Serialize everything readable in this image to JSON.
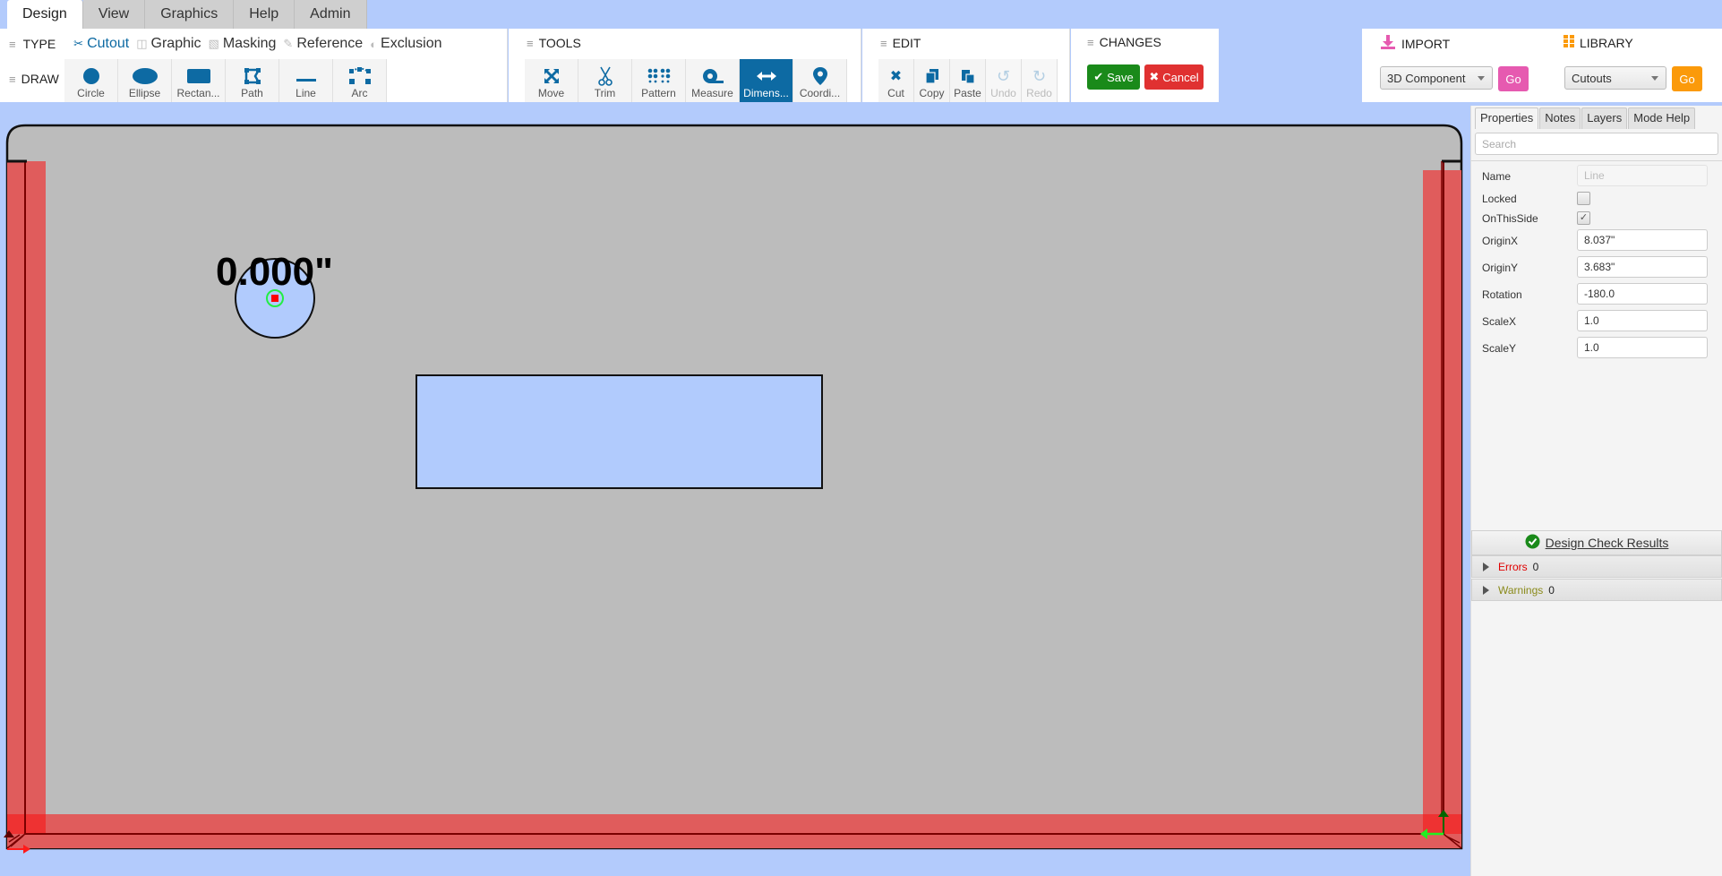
{
  "menu_tabs": [
    {
      "label": "Design",
      "active": true
    },
    {
      "label": "View",
      "active": false
    },
    {
      "label": "Graphics",
      "active": false
    },
    {
      "label": "Help",
      "active": false
    },
    {
      "label": "Admin",
      "active": false
    }
  ],
  "type_section": {
    "title": "TYPE",
    "items": [
      {
        "label": "Cutout",
        "icon": "scissors-icon",
        "active": true
      },
      {
        "label": "Graphic",
        "icon": "image-file-icon",
        "active": false
      },
      {
        "label": "Masking",
        "icon": "masking-tape-icon",
        "active": false
      },
      {
        "label": "Reference",
        "icon": "edit-icon",
        "active": false
      },
      {
        "label": "Exclusion",
        "icon": "half-circle-icon",
        "active": false
      }
    ]
  },
  "draw_section": {
    "title": "DRAW",
    "items": [
      {
        "label": "Circle",
        "icon": "circle-icon"
      },
      {
        "label": "Ellipse",
        "icon": "ellipse-icon"
      },
      {
        "label": "Rectan...",
        "icon": "rectangle-icon"
      },
      {
        "label": "Path",
        "icon": "path-icon"
      },
      {
        "label": "Line",
        "icon": "line-icon"
      },
      {
        "label": "Arc",
        "icon": "arc-icon"
      }
    ]
  },
  "tools_section": {
    "title": "TOOLS",
    "items": [
      {
        "label": "Move",
        "icon": "move-icon",
        "active": false
      },
      {
        "label": "Trim",
        "icon": "scissors-icon",
        "active": false
      },
      {
        "label": "Pattern",
        "icon": "pattern-grid-icon",
        "active": false
      },
      {
        "label": "Measure",
        "icon": "tape-measure-icon",
        "active": false
      },
      {
        "label": "Dimens...",
        "icon": "dimension-arrows-icon",
        "active": true
      },
      {
        "label": "Coordi...",
        "icon": "map-pin-icon",
        "active": false
      }
    ]
  },
  "edit_section": {
    "title": "EDIT",
    "items": [
      {
        "label": "Cut",
        "icon": "scissors-icon",
        "disabled": false
      },
      {
        "label": "Copy",
        "icon": "copy-icon",
        "disabled": false
      },
      {
        "label": "Paste",
        "icon": "paste-icon",
        "disabled": false
      },
      {
        "label": "Undo",
        "icon": "undo-icon",
        "disabled": true
      },
      {
        "label": "Redo",
        "icon": "redo-icon",
        "disabled": true
      }
    ]
  },
  "changes_section": {
    "title": "CHANGES",
    "save_label": "Save",
    "cancel_label": "Cancel",
    "save_color": "#1a8a1a",
    "cancel_color": "#e03131"
  },
  "import_section": {
    "title": "IMPORT",
    "selected": "3D Component",
    "go_label": "Go",
    "accent": "#e65ab0"
  },
  "library_section": {
    "title": "LIBRARY",
    "selected": "Cutouts",
    "go_label": "Go",
    "accent": "#fb9a0a"
  },
  "canvas": {
    "dimension_label": "0.000\"",
    "background": "#bcbcbc",
    "shape_fill": "#b1cbfd",
    "margin_fill": "#e05c5c"
  },
  "properties_panel": {
    "tabs": [
      {
        "label": "Properties",
        "active": true
      },
      {
        "label": "Notes",
        "active": false
      },
      {
        "label": "Layers",
        "active": false
      },
      {
        "label": "Mode Help",
        "active": false
      }
    ],
    "search_placeholder": "Search",
    "fields": {
      "name": {
        "label": "Name",
        "value": "Line"
      },
      "locked": {
        "label": "Locked",
        "checked": false
      },
      "on_this_side": {
        "label": "OnThisSide",
        "checked": true
      },
      "origin_x": {
        "label": "OriginX",
        "value": "8.037\""
      },
      "origin_y": {
        "label": "OriginY",
        "value": "3.683\""
      },
      "rotation": {
        "label": "Rotation",
        "value": "-180.0"
      },
      "scale_x": {
        "label": "ScaleX",
        "value": "1.0"
      },
      "scale_y": {
        "label": "ScaleY",
        "value": "1.0"
      }
    },
    "design_check": {
      "title": "Design Check Results",
      "errors_label": "Errors",
      "errors_count": "0",
      "warnings_label": "Warnings",
      "warnings_count": "0"
    }
  }
}
